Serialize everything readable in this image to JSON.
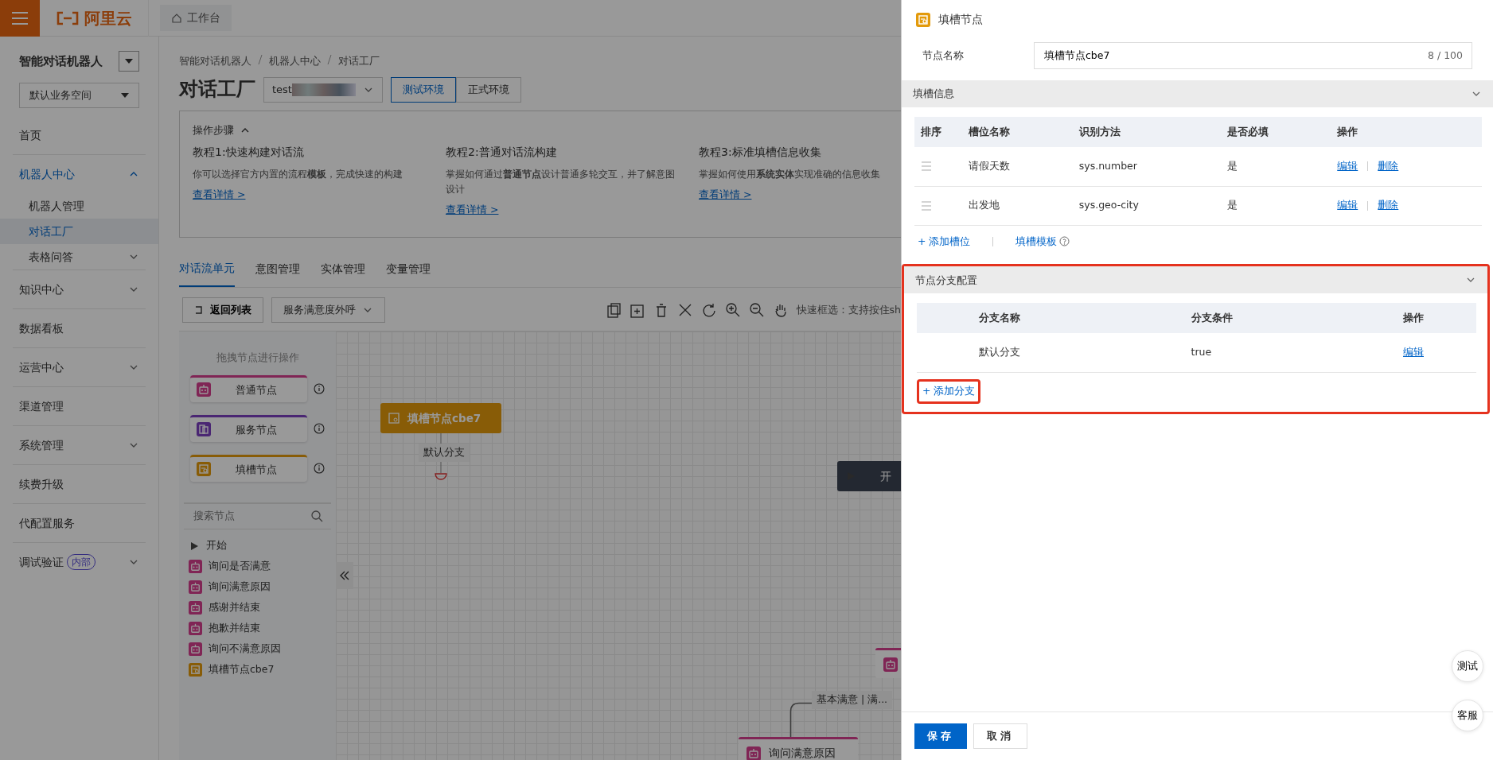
{
  "top_bar": {
    "logo_text": "阿里云",
    "workbench_tab": "工作台"
  },
  "sidebar": {
    "title": "智能对话机器人",
    "workspace": "默认业务空间",
    "items": [
      {
        "label": "首页",
        "selected": false
      },
      {
        "label": "机器人中心",
        "selected": false,
        "expanded": true,
        "children": [
          {
            "label": "机器人管理",
            "selected": false
          },
          {
            "label": "对话工厂",
            "selected": true
          },
          {
            "label": "表格问答",
            "selected": false,
            "expanded": false
          }
        ]
      },
      {
        "label": "知识中心",
        "selected": false,
        "expanded": false
      },
      {
        "label": "数据看板",
        "selected": false
      },
      {
        "label": "运营中心",
        "selected": false,
        "expanded": false
      },
      {
        "label": "渠道管理",
        "selected": false
      },
      {
        "label": "系统管理",
        "selected": false,
        "expanded": false
      },
      {
        "label": "续费升级",
        "selected": false
      },
      {
        "label": "代配置服务",
        "selected": false
      },
      {
        "label": "调试验证",
        "selected": false,
        "expanded": false,
        "badge": "内部"
      }
    ]
  },
  "breadcrumb": [
    "智能对话机器人",
    "机器人中心",
    "对话工厂"
  ],
  "page_title": "对话工厂",
  "bot_select": {
    "value": "test"
  },
  "environments": [
    {
      "label": "测试环境",
      "selected": true
    },
    {
      "label": "正式环境",
      "selected": false
    }
  ],
  "steps": {
    "title": "操作步骤",
    "expanded": true,
    "tutorials": [
      {
        "title": "教程1:快速构建对话流",
        "text": "你可以选择官方内置的流程**模板**，完成快速的构建",
        "link": "查看详情 >"
      },
      {
        "title": "教程2:普通对话流构建",
        "text": "掌握如何通过**普通节点**设计普通多轮交互，并了解意图设计",
        "link": "查看详情 >"
      },
      {
        "title": "教程3:标准填槽信息收集",
        "text": "掌握如何使用**系统实体**实现准确的信息收集",
        "link": "查看详情 >"
      }
    ]
  },
  "tabs": [
    {
      "label": "对话流单元",
      "selected": true
    },
    {
      "label": "意图管理",
      "selected": false
    },
    {
      "label": "实体管理",
      "selected": false
    },
    {
      "label": "变量管理",
      "selected": false
    }
  ],
  "toolbar": {
    "back_button": "返回列表",
    "flow_select": "服务满意度外呼",
    "hint": "快速框选：支持按住sh"
  },
  "node_palette": {
    "title": "拖拽节点进行操作",
    "nodes": [
      {
        "label": "普通节点",
        "kind": "normal"
      },
      {
        "label": "服务节点",
        "kind": "service"
      },
      {
        "label": "填槽节点",
        "kind": "slot"
      }
    ]
  },
  "node_search": {
    "placeholder": "搜索节点"
  },
  "node_list": [
    {
      "label": "开始",
      "kind": "start"
    },
    {
      "label": "询问是否满意",
      "kind": "normal"
    },
    {
      "label": "询问满意原因",
      "kind": "normal"
    },
    {
      "label": "感谢并结束",
      "kind": "normal"
    },
    {
      "label": "抱歉并结束",
      "kind": "normal"
    },
    {
      "label": "询问不满意原因",
      "kind": "normal"
    },
    {
      "label": "填槽节点cbe7",
      "kind": "slot"
    }
  ],
  "canvas": {
    "nodes": [
      {
        "label": "填槽节点cbe7",
        "kind": "slot"
      },
      {
        "label": "开",
        "kind": "start"
      },
      {
        "kind": "normal"
      },
      {
        "label": "询问满意原因",
        "kind": "normal"
      }
    ],
    "edge_labels": [
      "默认分支",
      "基本满意 | 满..."
    ]
  },
  "drawer": {
    "title": "填槽节点",
    "name_field": {
      "label": "节点名称",
      "value": "填槽节点cbe7",
      "counter": "8 / 100"
    },
    "sections": [
      {
        "kind": "slots",
        "title": "填槽信息",
        "expanded": true,
        "highlighted": false,
        "columns": [
          "排序",
          "槽位名称",
          "识别方法",
          "是否必填",
          "操作"
        ],
        "rows": [
          {
            "name": "请假天数",
            "method": "sys.number",
            "required": "是",
            "actions": [
              "编辑",
              "删除"
            ]
          },
          {
            "name": "出发地",
            "method": "sys.geo-city",
            "required": "是",
            "actions": [
              "编辑",
              "删除"
            ]
          }
        ],
        "links": [
          {
            "label": "+ 添加槽位",
            "help": false,
            "highlighted": false
          },
          {
            "label": "填槽模板",
            "help": true,
            "highlighted": false
          }
        ]
      },
      {
        "kind": "branches",
        "title": "节点分支配置",
        "expanded": true,
        "highlighted": true,
        "columns": [
          "分支名称",
          "分支条件",
          "操作"
        ],
        "rows": [
          {
            "name": "默认分支",
            "condition": "true",
            "actions": [
              "编辑"
            ]
          }
        ],
        "links": [
          {
            "label": "+ 添加分支",
            "help": false,
            "highlighted": true
          }
        ]
      }
    ],
    "buttons": [
      {
        "label": "保存",
        "primary": true
      },
      {
        "label": "取消",
        "primary": false
      }
    ]
  },
  "float_buttons": [
    "测试",
    "客服"
  ]
}
